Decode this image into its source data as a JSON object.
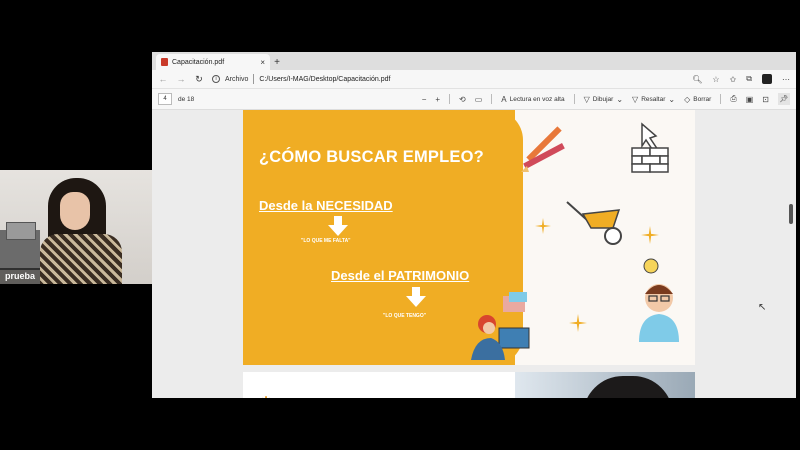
{
  "participant": {
    "name": "prueba"
  },
  "browser": {
    "tab": {
      "title": "Capacitación.pdf",
      "close": "×"
    },
    "new_tab": "+",
    "address": {
      "site_label": "Archivo",
      "url": "C:/Users/I-MAG/Desktop/Capacitación.pdf"
    }
  },
  "pdf_toolbar": {
    "page_current": "4",
    "page_total": "de 18",
    "read_aloud": "Lectura en voz alta",
    "draw": "Dibujar",
    "highlight": "Resaltar",
    "erase": "Borrar"
  },
  "slide": {
    "title": "¿CÓMO BUSCAR EMPLEO?",
    "need": "Desde la NECESIDAD",
    "need_sub": "\"LO QUE ME FALTA\"",
    "patrimony": "Desde el PATRIMONIO",
    "patrimony_sub": "\"LO QUE TENGO\""
  },
  "colors": {
    "slide_orange": "#f0ad24",
    "pdf_icon": "#c93a2a"
  }
}
